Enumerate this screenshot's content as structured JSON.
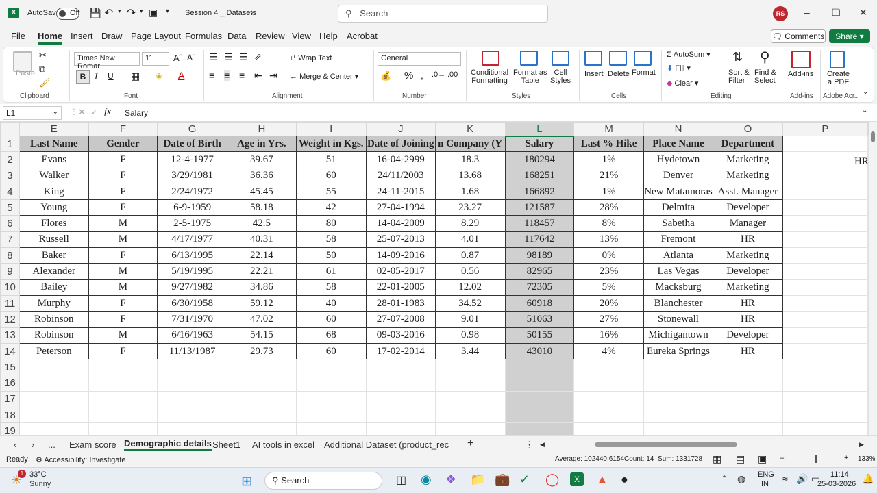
{
  "titlebar": {
    "autosave_label": "AutoSave",
    "autosave_state": "Off",
    "doc_title": "Session 4 _ Datasets",
    "search_placeholder": "Search",
    "avatar_initials": "RS"
  },
  "menu": {
    "items": [
      "File",
      "Home",
      "Insert",
      "Draw",
      "Page Layout",
      "Formulas",
      "Data",
      "Review",
      "View",
      "Help",
      "Acrobat"
    ],
    "active": "Home",
    "comments": "Comments",
    "share": "Share"
  },
  "ribbon": {
    "paste": "Paste",
    "clipboard": "Clipboard",
    "font_name": "Times New Romar",
    "font_size": "11",
    "font": "Font",
    "wrap_text": "Wrap Text",
    "merge_center": "Merge & Center",
    "alignment": "Alignment",
    "number_format": "General",
    "number": "Number",
    "conditional_formatting": "Conditional\nFormatting",
    "format_as_table": "Format as\nTable",
    "cell_styles": "Cell\nStyles",
    "styles": "Styles",
    "insert": "Insert",
    "delete": "Delete",
    "format": "Format",
    "cells": "Cells",
    "autosum": "AutoSum",
    "fill": "Fill",
    "clear": "Clear",
    "sort_filter": "Sort &\nFilter",
    "find_select": "Find &\nSelect",
    "editing": "Editing",
    "addins": "Add-ins",
    "addins_group": "Add-ins",
    "create_pdf": "Create\na PDF",
    "adobe": "Adobe Acr..."
  },
  "formula_bar": {
    "name_box": "L1",
    "fx": "fx",
    "content": "Salary"
  },
  "sheet": {
    "columns": [
      "E",
      "F",
      "G",
      "H",
      "I",
      "J",
      "K",
      "L",
      "M",
      "N",
      "O",
      "P"
    ],
    "headers": [
      "Last Name",
      "Gender",
      "Date of Birth",
      "Age in Yrs.",
      "Weight in Kgs.",
      "Date of Joining",
      "n Company (Y",
      "Salary",
      "Last % Hike",
      "Place Name",
      "Department"
    ],
    "rows": [
      [
        "Evans",
        "F",
        "12-4-1977",
        "39.67",
        "51",
        "16-04-2999",
        "18.3",
        "180294",
        "1%",
        "Hydetown",
        "Marketing"
      ],
      [
        "Walker",
        "F",
        "3/29/1981",
        "36.36",
        "60",
        "24/11/2003",
        "13.68",
        "168251",
        "21%",
        "Denver",
        "Marketing"
      ],
      [
        "King",
        "F",
        "2/24/1972",
        "45.45",
        "55",
        "24-11-2015",
        "1.68",
        "166892",
        "1%",
        "New Matamoras",
        "Asst. Manager"
      ],
      [
        "Young",
        "F",
        "6-9-1959",
        "58.18",
        "42",
        "27-04-1994",
        "23.27",
        "121587",
        "28%",
        "Delmita",
        "Developer"
      ],
      [
        "Flores",
        "M",
        "2-5-1975",
        "42.5",
        "80",
        "14-04-2009",
        "8.29",
        "118457",
        "8%",
        "Sabetha",
        "Manager"
      ],
      [
        "Russell",
        "M",
        "4/17/1977",
        "40.31",
        "58",
        "25-07-2013",
        "4.01",
        "117642",
        "13%",
        "Fremont",
        "HR"
      ],
      [
        "Baker",
        "F",
        "6/13/1995",
        "22.14",
        "50",
        "14-09-2016",
        "0.87",
        "98189",
        "0%",
        "Atlanta",
        "Marketing"
      ],
      [
        "Alexander",
        "M",
        "5/19/1995",
        "22.21",
        "61",
        "02-05-2017",
        "0.56",
        "82965",
        "23%",
        "Las Vegas",
        "Developer"
      ],
      [
        "Bailey",
        "M",
        "9/27/1982",
        "34.86",
        "58",
        "22-01-2005",
        "12.02",
        "72305",
        "5%",
        "Macksburg",
        "Marketing"
      ],
      [
        "Murphy",
        "F",
        "6/30/1958",
        "59.12",
        "40",
        "28-01-1983",
        "34.52",
        "60918",
        "20%",
        "Blanchester",
        "HR"
      ],
      [
        "Robinson",
        "F",
        "7/31/1970",
        "47.02",
        "60",
        "27-07-2008",
        "9.01",
        "51063",
        "27%",
        "Stonewall",
        "HR"
      ],
      [
        "Robinson",
        "M",
        "6/16/1963",
        "54.15",
        "68",
        "09-03-2016",
        "0.98",
        "50155",
        "16%",
        "Michigantown",
        "Developer"
      ],
      [
        "Peterson",
        "F",
        "11/13/1987",
        "29.73",
        "60",
        "17-02-2014",
        "3.44",
        "43010",
        "4%",
        "Eureka Springs",
        "HR"
      ]
    ],
    "stray_cell": "HR",
    "row_numbers": [
      1,
      2,
      3,
      4,
      5,
      6,
      7,
      8,
      9,
      10,
      11,
      12,
      13,
      14,
      15,
      16,
      17,
      18,
      19
    ]
  },
  "tabs": {
    "items": [
      "Exam score",
      "Demographic details",
      "Sheet1",
      "AI tools in excel",
      "Additional Dataset (product_rec"
    ],
    "active": "Demographic details",
    "more": "..."
  },
  "status": {
    "ready": "Ready",
    "accessibility": "Accessibility: Investigate",
    "average": "Average: 102440.6154",
    "count": "Count: 14",
    "sum": "Sum: 1331728",
    "zoom": "133%"
  },
  "taskbar": {
    "temp": "33°C",
    "weather": "Sunny",
    "search": "Search",
    "lang1": "ENG",
    "lang2": "IN",
    "time": "11:14",
    "date": "25-03-2026",
    "notif": "1"
  },
  "colors": {
    "excel_green": "#107c41",
    "header_fill": "#c8c8c8",
    "selection_fill": "#d0d0d0"
  }
}
